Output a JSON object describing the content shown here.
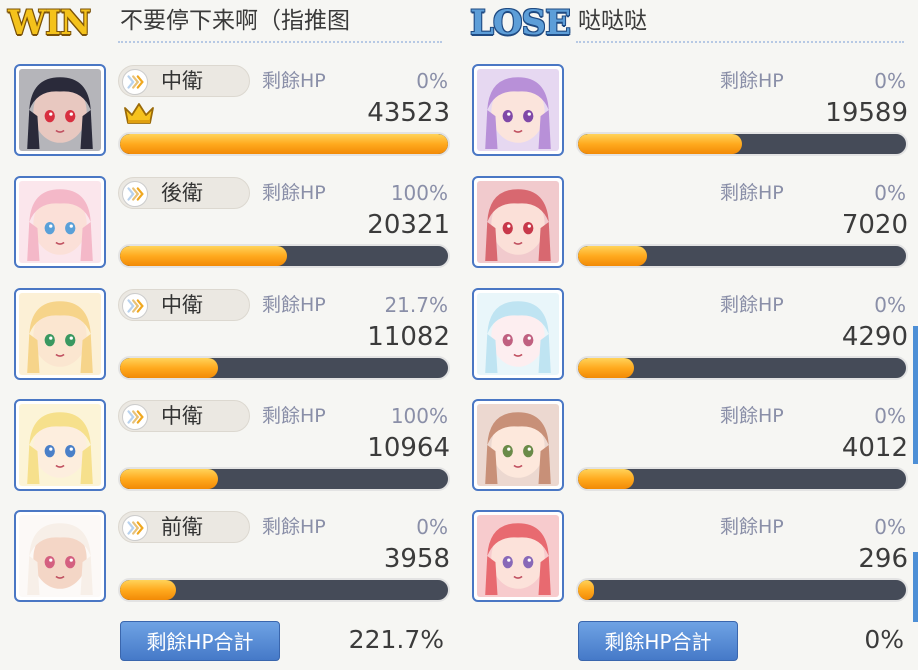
{
  "win_team": {
    "result_label": "WIN",
    "team_name": "不要停下来啊（指推图",
    "hp_label": "剩餘HP",
    "total_label": "剩餘HP合計",
    "total_value": "221.7%",
    "members": [
      {
        "role": "中衛",
        "remaining_hp": "0%",
        "damage": "43523",
        "damage_fraction": 1.0,
        "mvp": true
      },
      {
        "role": "後衛",
        "remaining_hp": "100%",
        "damage": "20321",
        "damage_fraction": 0.51
      },
      {
        "role": "中衛",
        "remaining_hp": "21.7%",
        "damage": "11082",
        "damage_fraction": 0.3
      },
      {
        "role": "中衛",
        "remaining_hp": "100%",
        "damage": "10964",
        "damage_fraction": 0.3
      },
      {
        "role": "前衛",
        "remaining_hp": "0%",
        "damage": "3958",
        "damage_fraction": 0.17
      }
    ]
  },
  "lose_team": {
    "result_label": "LOSE",
    "team_name": "哒哒哒",
    "hp_label": "剩餘HP",
    "total_label": "剩餘HP合計",
    "total_value": "0%",
    "members": [
      {
        "remaining_hp": "0%",
        "damage": "19589",
        "damage_fraction": 0.5
      },
      {
        "remaining_hp": "0%",
        "damage": "7020",
        "damage_fraction": 0.21
      },
      {
        "remaining_hp": "0%",
        "damage": "4290",
        "damage_fraction": 0.17
      },
      {
        "remaining_hp": "0%",
        "damage": "4012",
        "damage_fraction": 0.17
      },
      {
        "remaining_hp": "0%",
        "damage": "296",
        "damage_fraction": 0.05
      }
    ]
  },
  "icons": {
    "crown": "crown-icon",
    "role_chevron": "chevron-right-icon"
  },
  "colors": {
    "bar_fill": "#ffaa1e",
    "bar_track": "#454b58",
    "portrait_border": "#4a77c4",
    "win_gold": "#f4c21b",
    "lose_blue": "#5d9ed8",
    "total_button": "#5a8ed6"
  }
}
